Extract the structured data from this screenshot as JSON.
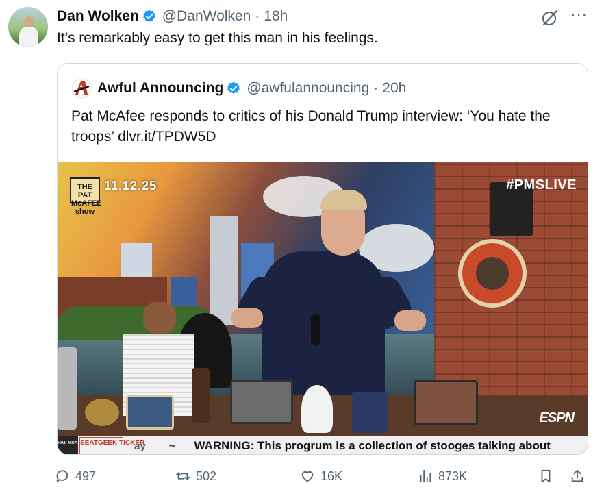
{
  "author": {
    "name": "Dan Wolken",
    "handle": "@DanWolken",
    "separator": "·",
    "time": "18h"
  },
  "tweet_text": "It’s remarkably easy to get this man in his feelings.",
  "menu_glyph": "···",
  "quote": {
    "name": "Awful Announcing",
    "handle": "@awfulannouncing",
    "separator": "·",
    "time": "20h",
    "text": "Pat McAfee responds to critics of his Donald Trump interview: ‘You hate the troops’ dlvr.it/TPDW5D",
    "media": {
      "show_logo": "THE PAT McAFEE show",
      "date": "11.12.25",
      "hashtag": "#PMSLIVE",
      "network": "ESPN",
      "ticker_logo": "PAT McAFEE",
      "ticker_sponsor": "SEATGEEK TICKER",
      "ticker_fragment": "ay",
      "ticker_tilde": "~",
      "ticker_text": "WARNING: This progrum is a collection of stooges talking about"
    }
  },
  "actions": {
    "replies": "497",
    "reposts": "502",
    "likes": "16K",
    "views": "873K"
  },
  "colors": {
    "verified": "#1d9bf0",
    "muted_text": "#536471",
    "border": "#cfd9de"
  },
  "icons": [
    "verified-badge-icon",
    "grok-icon",
    "more-icon",
    "reply-icon",
    "repost-icon",
    "like-icon",
    "views-icon",
    "bookmark-icon",
    "share-icon"
  ]
}
